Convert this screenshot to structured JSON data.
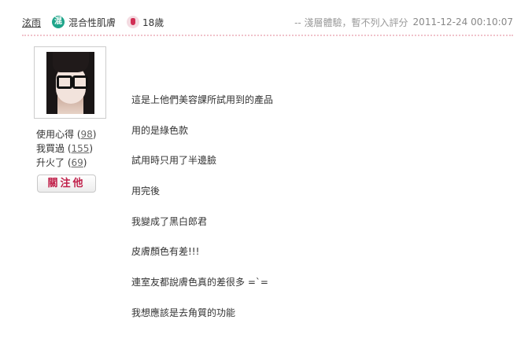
{
  "header": {
    "username": "泫雨",
    "skin_icon_char": "混",
    "skin_type": "混合性肌膚",
    "age": "18歲",
    "note": "-- 淺層體驗，暫不列入評分",
    "timestamp": "2011-12-24 00:10:07"
  },
  "sidebar": {
    "stats": [
      {
        "label": "使用心得",
        "count": "98"
      },
      {
        "label": "我買過",
        "count": "155"
      },
      {
        "label": "升火了",
        "count": "69"
      }
    ],
    "follow_label": "關注他"
  },
  "content": {
    "lines": [
      "這是上他們美容課所試用到的產品",
      "用的是綠色款",
      "試用時只用了半邊臉",
      "用完後",
      "我變成了黑白郎君",
      "皮膚顏色有差!!!",
      "連室友都說膚色真的差很多 =`=",
      "我想應該是去角質的功能"
    ]
  },
  "colors": {
    "accent": "#c0204a",
    "skin_badge": "#1fa58a",
    "divider": "#f0c2ca"
  }
}
